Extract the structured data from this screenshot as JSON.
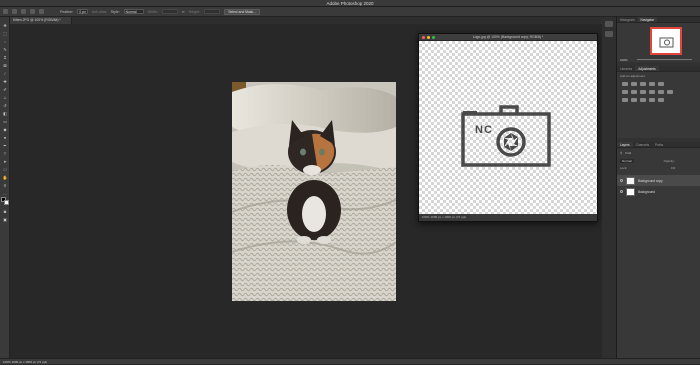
{
  "app": {
    "title": "Adobe Photoshop 2020"
  },
  "options_bar": {
    "feather_label": "Feather:",
    "feather_value": "0 px",
    "antialias_label": "Anti-alias",
    "style_label": "Style:",
    "style_value": "Normal",
    "width_label": "Width:",
    "height_label": "Height:",
    "select_mask_label": "Select and Mask..."
  },
  "document": {
    "tab_label": "Kitten.JPG @ 100% (RGB/8#) *",
    "status_text": "100%   1000 px x 1500 px (72 ppi)"
  },
  "logo_window": {
    "title": "Logo.jpg @ 100% (Background copy, RGB/8) *",
    "logo_text": "NC",
    "status_text": "100%     1000 px x 1000 px (72 ppi)",
    "traffic_colors": [
      "#ff5f57",
      "#febc2e",
      "#28c840"
    ]
  },
  "panels": {
    "histogram_tab": "Histogram",
    "navigator_tab": "Navigator",
    "nav_zoom": "100%",
    "libraries_tab": "Libraries",
    "adjustments_tab": "Adjustments",
    "adjustments_hint": "Add an adjustment",
    "layers_tab": "Layers",
    "channels_tab": "Channels",
    "paths_tab": "Paths",
    "kind_label": "Kind",
    "blend_mode": "Normal",
    "opacity_label": "Opacity:",
    "lock_label": "Lock:",
    "fill_label": "Fill:",
    "layers": [
      {
        "name": "Background copy"
      },
      {
        "name": "Background"
      }
    ]
  },
  "colors": {
    "accent": "#2d7de0",
    "logo_gray": "#4a4a4a"
  }
}
